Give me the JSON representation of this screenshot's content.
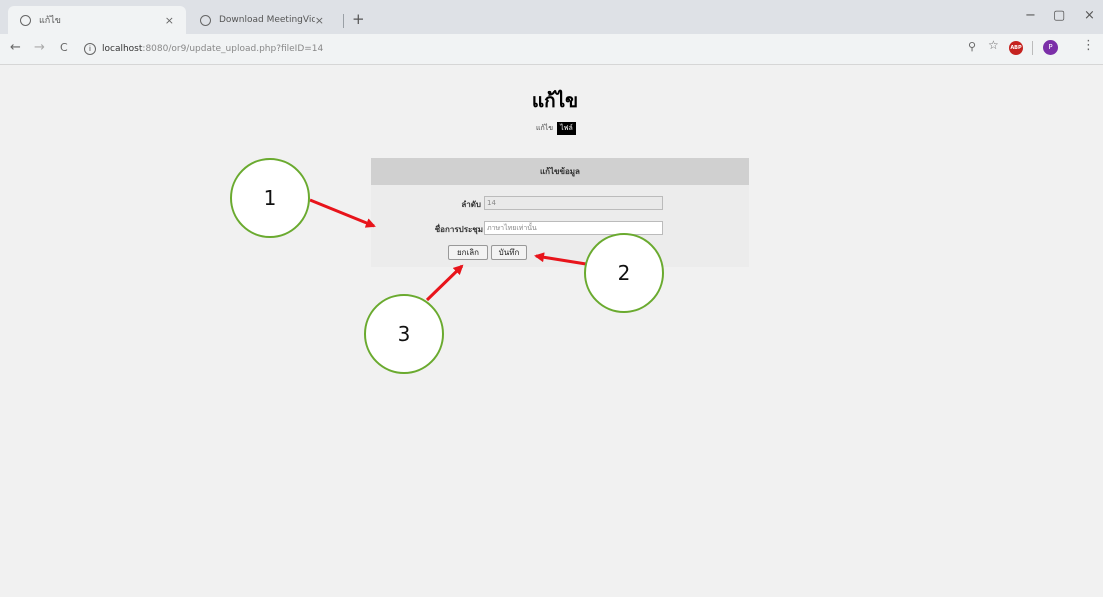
{
  "browser": {
    "tabs": [
      {
        "title": "แก้ไข",
        "close": "×"
      },
      {
        "title": "Download MeetingVideo",
        "close": "×"
      }
    ],
    "new_tab": "+",
    "window_controls": {
      "minimize": "−",
      "maximize": "▢",
      "close": "×"
    },
    "url_host": "localhost",
    "url_rest": ":8080/or9/update_upload.php?fileID=14",
    "nav": {
      "back": "←",
      "forward": "→",
      "reload": "C"
    },
    "toolbar": {
      "info": "i",
      "zoom": "⚲",
      "star": "☆",
      "abp": "ABP",
      "profile": "P",
      "menu": "⋮"
    }
  },
  "page": {
    "title": "แก้ไข",
    "breadcrumb_edit": "แก้ไข",
    "breadcrumb_file": "ไฟล์"
  },
  "form": {
    "header": "แก้ไขข้อมูล",
    "order_label": "ลำดับ",
    "order_value": "14",
    "meeting_label": "ชื่อการประชุม",
    "meeting_value": "ภาษาไทยเท่านั้น",
    "cancel_label": "ยกเลิก",
    "save_label": "บันทึก"
  },
  "annotations": {
    "n1": "1",
    "n2": "2",
    "n3": "3"
  },
  "colors": {
    "arrow": "#e8141b",
    "circle_border": "#6aaa2f"
  }
}
